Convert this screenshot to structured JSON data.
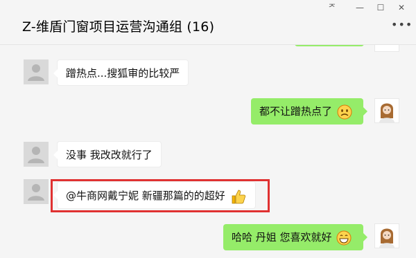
{
  "window": {
    "title": "Z-维盾门窗项目运营沟通组 (16)",
    "controls": {
      "pin": "ᅎ",
      "minimize": "—",
      "maximize": "☐",
      "close": "✕"
    },
    "more_menu": "•••"
  },
  "messages": [
    {
      "side": "left",
      "text": "蹭热点...搜狐审的比较严"
    },
    {
      "side": "right",
      "text": "都不让蹭热点了",
      "emoji": "worried-face"
    },
    {
      "side": "left",
      "text": "没事  我改改就行了"
    },
    {
      "side": "left",
      "text": "@牛商网戴宁妮  新疆那篇的的超好",
      "emoji": "thumbs-up",
      "highlighted": true
    },
    {
      "side": "right",
      "text": "哈哈  丹姐  您喜欢就好",
      "emoji": "grinning-face"
    }
  ],
  "colors": {
    "own_bubble": "#95ec69",
    "other_bubble": "#ffffff",
    "highlight_border": "#e03131",
    "background": "#f5f5f5"
  }
}
